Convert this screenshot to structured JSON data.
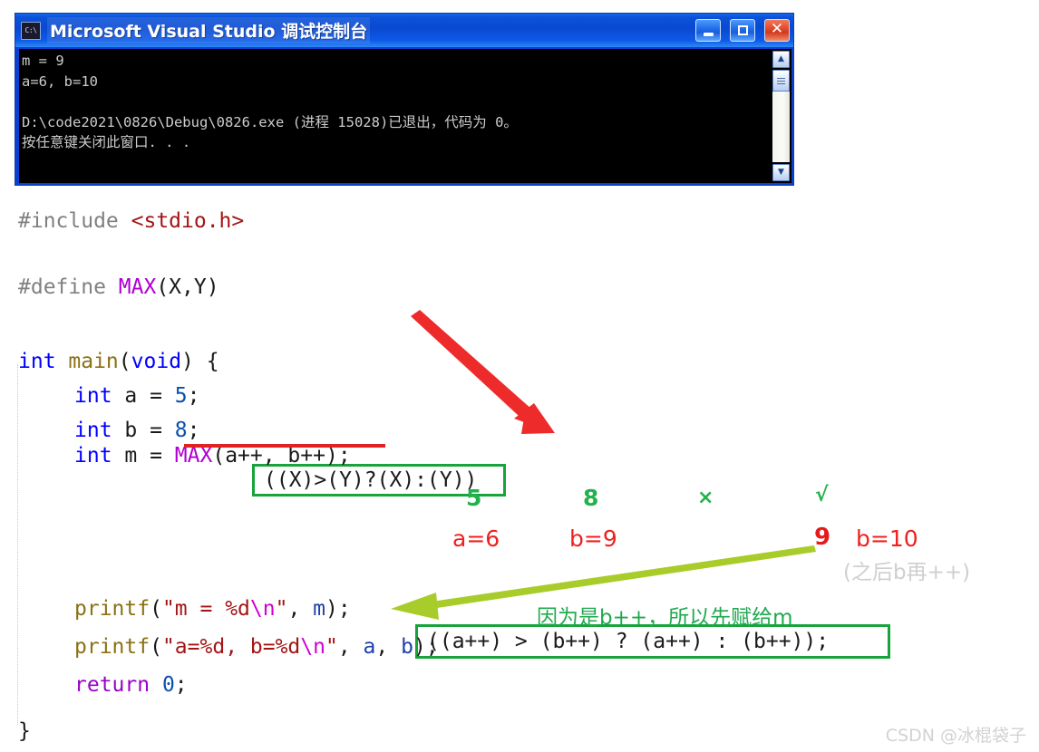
{
  "console": {
    "title": "Microsoft Visual Studio 调试控制台",
    "app_icon": "console-app-icon",
    "buttons": {
      "minimize": "minimize-button",
      "maximize": "maximize-button",
      "close": "close-button"
    },
    "output": "m = 9\na=6, b=10\n\nD:\\code2021\\0826\\Debug\\0826.exe (进程 15028)已退出，代码为 0。\n按任意键关闭此窗口. . .",
    "scrollbar": {
      "up_arrow": "▲",
      "down_arrow": "▼"
    }
  },
  "code": {
    "line_include_pre": "#include ",
    "line_include_header": "<stdio.h>",
    "line_define_pre": "#define ",
    "line_define_macro": "MAX",
    "line_define_params": "(X,Y)",
    "define_body_boxed": "((X)>(Y)?(X):(Y))",
    "line_main_kw": "int",
    "line_main_name": " main",
    "line_main_paren_open": "(",
    "line_main_void": "void",
    "line_main_tail": ") {",
    "line_a_kw": "int",
    "line_a_rest": " a = ",
    "line_a_num": "5",
    "line_a_end": ";",
    "line_b_kw": "int",
    "line_b_rest": " b = ",
    "line_b_num": "8",
    "line_b_end": ";",
    "line_m_kw": "int",
    "line_m_rest": " m = ",
    "line_m_macro": "MAX",
    "line_m_args": "(a++, b++);",
    "expanded_boxed": "((a++) > (b++) ? (a++) : (b++));",
    "printf1_fn": "printf",
    "printf1_open": "(",
    "printf1_str_a": "\"m = %d",
    "printf1_esc": "\\n",
    "printf1_str_b": "\"",
    "printf1_comma": ", ",
    "printf1_var": "m",
    "printf1_close": ");",
    "printf2_fn": "printf",
    "printf2_open": "(",
    "printf2_str_a": "\"a=%d, b=%d",
    "printf2_esc": "\\n",
    "printf2_str_b": "\"",
    "printf2_comma": ", ",
    "printf2_var_a": "a",
    "printf2_mid": ", ",
    "printf2_var_b": "b",
    "printf2_close": ");",
    "return_kw": "return",
    "return_val": " 0",
    "return_end": ";",
    "closing_brace": "}"
  },
  "annotations": {
    "green_values": [
      "5",
      "8"
    ],
    "cross_symbol": "×",
    "check_symbol": "√",
    "red_a": "a=6",
    "red_b": "b=9",
    "red_result": "9",
    "red_b2": "b=10",
    "gray_note": "(之后b再++)",
    "green_note": "因为是b++，所以先赋给m",
    "red_arrow": "red-arrow-define-to-expansion",
    "green_arrow": "green-arrow-result-to-printf"
  },
  "watermark": "CSDN @冰棍袋子",
  "colors": {
    "title_blue": "#0a49d2",
    "console_bg": "#000000",
    "box_green": "#19a33c",
    "anno_green": "#22b24c",
    "anno_red": "#ef2020",
    "red_arrow": "#ee2b2b",
    "green_arrow": "#a8cc29",
    "gray_note": "#cfcfcf"
  }
}
